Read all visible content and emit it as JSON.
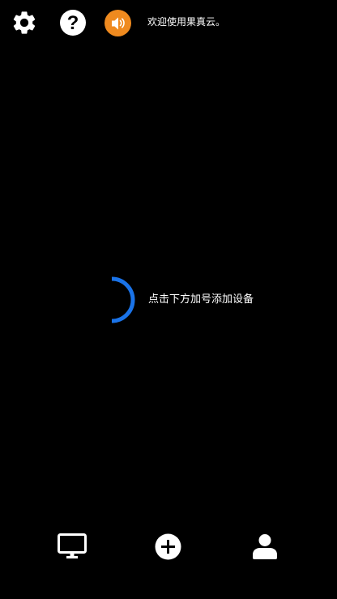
{
  "header": {
    "welcome_text": "欢迎使用果真云。",
    "icons": {
      "settings": "gear-icon",
      "help": "question-icon",
      "speaker": "speaker-icon"
    }
  },
  "main": {
    "hint_text": "点击下方加号添加设备",
    "loading": "spinner-icon"
  },
  "bottom_nav": {
    "items": [
      {
        "icon": "monitor-icon"
      },
      {
        "icon": "add-icon"
      },
      {
        "icon": "user-icon"
      }
    ]
  },
  "colors": {
    "background": "#000000",
    "text": "#ffffff",
    "speaker_accent": "#ef8a1f",
    "spinner": "#1a73e8"
  }
}
